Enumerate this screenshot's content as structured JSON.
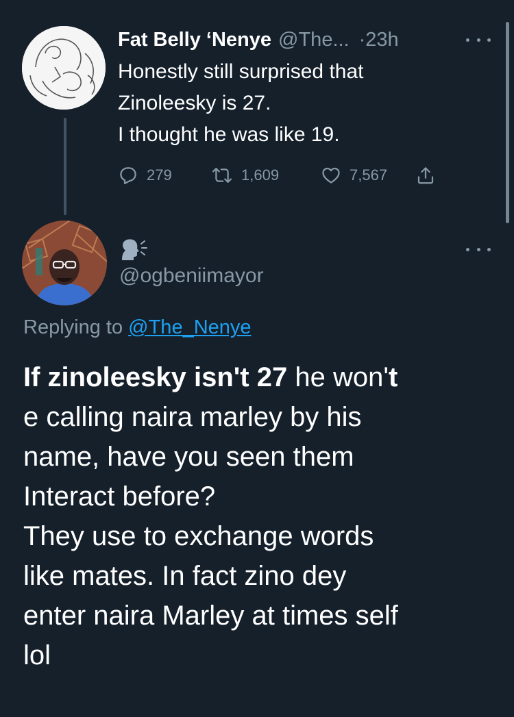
{
  "tweet1": {
    "name": "Fat Belly ‘Nenye",
    "handle": "@The...",
    "time": "·23h",
    "lines": [
      "Honestly still surprised that",
      "Zinoleesky is 27.",
      "I thought he was like 19."
    ],
    "replies": "279",
    "retweets": "1,609",
    "likes": "7,567"
  },
  "tweet2": {
    "handle": "@ogbeniimayor",
    "replying_prefix": "Replying to ",
    "replying_to": "@The_Nenye",
    "line1_bold_a": "If zinoleesky isn't 27",
    "line1_normal": " he won'",
    "line1_bold_b": "t",
    "lines": [
      "e calling naira marley by his",
      "name, have you seen them",
      "Interact before?",
      "They use to exchange words",
      "like mates. In fact zino dey",
      "enter naira Marley at times self",
      "lol"
    ]
  },
  "colors": {
    "background": "#15202b",
    "secondary_text": "#8899a6",
    "link": "#1da1f2"
  },
  "icons": [
    "more-icon",
    "reply-icon",
    "retweet-icon",
    "like-icon",
    "share-icon",
    "speaking-head-icon"
  ]
}
